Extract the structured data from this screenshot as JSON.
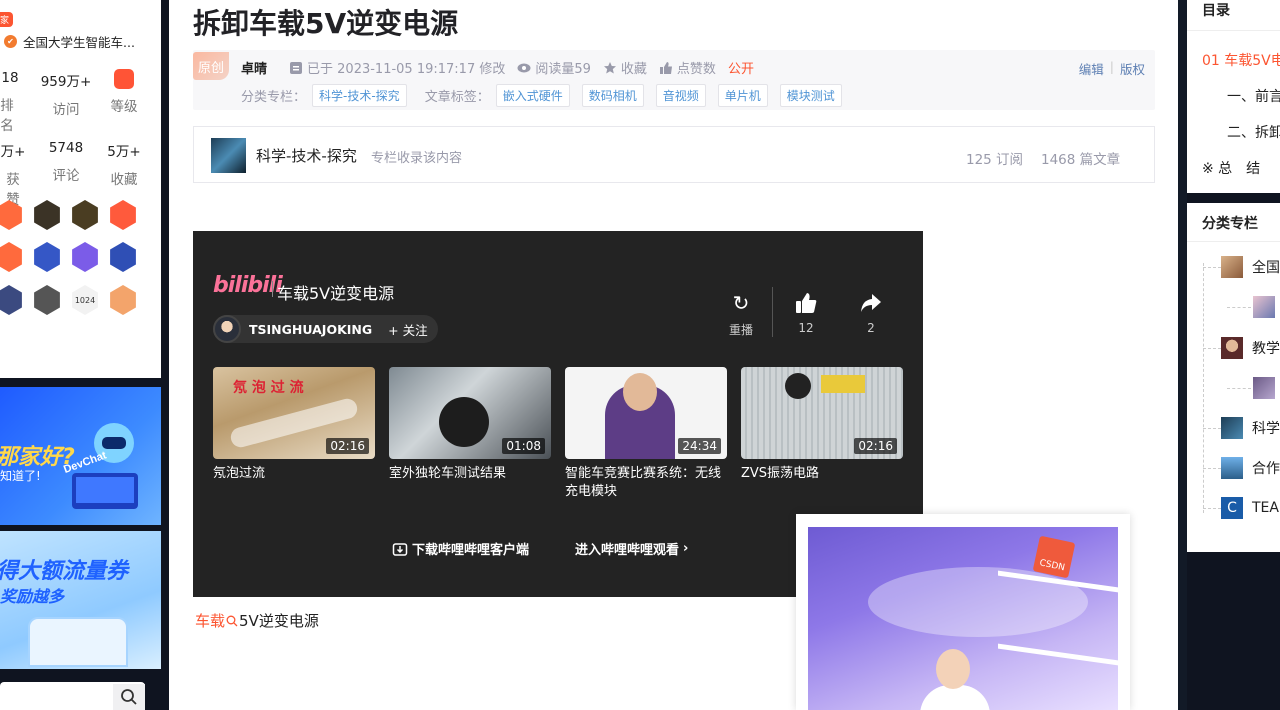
{
  "left": {
    "badge": "家",
    "competition": "全国大学生智能车...",
    "stats_row1": [
      {
        "value": "18",
        "label": "排名"
      },
      {
        "value": "959万+",
        "label": "访问"
      },
      {
        "value": "",
        "label": "等级"
      }
    ],
    "stats_row2": [
      {
        "value": "万+",
        "label": "获赞"
      },
      {
        "value": "5748",
        "label": "评论"
      },
      {
        "value": "5万+",
        "label": "收藏"
      }
    ],
    "medal_1024": "1024",
    "promo1_title": "那家好?",
    "promo1_sub": "知道了!",
    "promo1_brand": "DevChat",
    "promo2_title": "得大额流量券",
    "promo2_sub": "奖励越多"
  },
  "article": {
    "title": "拆卸车载5V逆变电源",
    "original_tag": "原创",
    "author": "卓晴",
    "modified": "已于 2023-11-05 19:17:17 修改",
    "reads": "阅读量59",
    "favorite": "收藏",
    "like": "点赞数",
    "visibility": "公开",
    "edit": "编辑",
    "copyright": "版权",
    "column_label": "分类专栏：",
    "column_tags": [
      "科学-技术-探究"
    ],
    "article_label": "文章标签：",
    "article_tags": [
      "嵌入式硬件",
      "数码相机",
      "音视频",
      "单片机",
      "模块测试"
    ]
  },
  "column_card": {
    "name": "科学-技术-探究",
    "desc": "专栏收录该内容",
    "subs": "125 订阅",
    "articles": "1468 篇文章"
  },
  "player": {
    "logo": "bilibili",
    "title": "车载5V逆变电源",
    "uploader": "TSINGHUAJOKING",
    "follow": "+ 关注",
    "replay": "重播",
    "likes": "12",
    "shares": "2",
    "videos": [
      {
        "title": "氖泡过流",
        "duration": "02:16"
      },
      {
        "title": "室外独轮车测试结果",
        "duration": "01:08"
      },
      {
        "title": "智能车竞赛比赛系统：无线充电模块",
        "duration": "24:34"
      },
      {
        "title": "ZVS振荡电路",
        "duration": "02:16"
      }
    ],
    "download": "下载哔哩哔哩客户端",
    "watch": "进入哔哩哔哩观看"
  },
  "hot_search": {
    "keyword": "车载",
    "rest": "5V逆变电源"
  },
  "ad": {
    "box_label": "CSDN"
  },
  "toc": {
    "header": "目录",
    "items": [
      "01 车载5V电",
      "一、前言",
      "二、拆卸",
      "※ 总　结"
    ]
  },
  "categories": {
    "header": "分类专栏",
    "items": [
      "全国",
      "",
      "教学",
      "",
      "科学",
      "合作",
      "TEA"
    ]
  },
  "colors": {
    "accent": "#fc5531",
    "link": "#5094d5",
    "bili": "#fb7299"
  }
}
